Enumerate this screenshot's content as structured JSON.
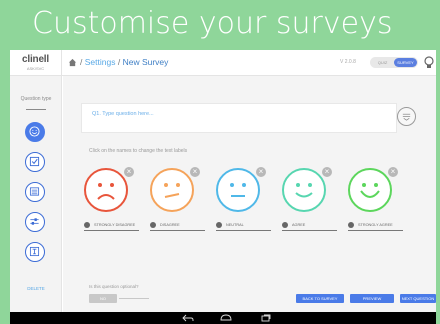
{
  "banner": {
    "title": "Customise your surveys"
  },
  "topbar": {
    "logo": "clinell",
    "logo_sub": "ASK/SVC",
    "crumb_separator": "/",
    "crumbs": [
      "Settings",
      "New Survey"
    ],
    "version": "V 2.0.8",
    "mode_toggle": {
      "off_label": "QUIZ",
      "on_label": "SURVEY",
      "selected": "SURVEY"
    }
  },
  "sidebar": {
    "question_type_label": "Question type",
    "question_types": [
      {
        "icon": "smiley-icon",
        "active": true
      },
      {
        "icon": "checkbox-icon",
        "active": false
      },
      {
        "icon": "list-icon",
        "active": false
      },
      {
        "icon": "slider-icon",
        "active": false
      },
      {
        "icon": "text-input-icon",
        "active": false
      }
    ],
    "delete_label": "DELETE"
  },
  "main": {
    "question_placeholder": "Q1. Type question here...",
    "hint": "Click on the names to change the text labels",
    "faces": [
      {
        "label": "STRONGLY DISAGREE",
        "color": "#e8553b",
        "mood": "very-sad"
      },
      {
        "label": "DISAGREE",
        "color": "#f5a35a",
        "mood": "sad"
      },
      {
        "label": "NEUTRAL",
        "color": "#4fb8e8",
        "mood": "neutral"
      },
      {
        "label": "AGREE",
        "color": "#57d6b0",
        "mood": "happy"
      },
      {
        "label": "STRONGLY AGREE",
        "color": "#5cd65c",
        "mood": "very-happy"
      }
    ],
    "optional_question": "Is this question optional?",
    "optional_value": "NO",
    "buttons": {
      "back": "BACK TO SURVEY",
      "preview": "PREVIEW",
      "next": "NEXT QUESTION"
    }
  },
  "colors": {
    "accent": "#4a7be8",
    "banner": "#8fd69a",
    "link": "#5aa9e6"
  }
}
